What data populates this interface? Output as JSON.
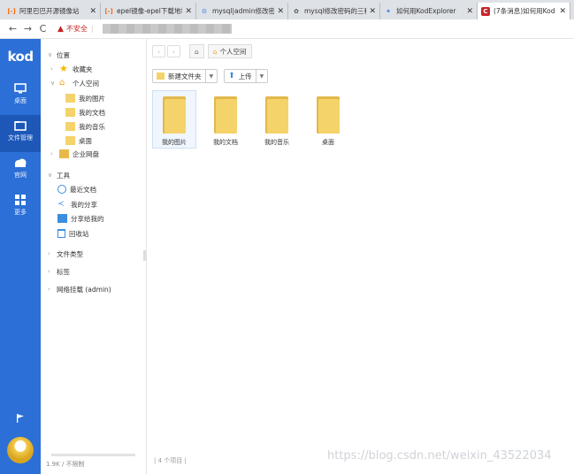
{
  "tabs": [
    {
      "title": "阿里巴巴开源镜像站",
      "fav_color": "#ff6a00",
      "fav_char": "[-]"
    },
    {
      "title": "epel镜像-epel下载地址",
      "fav_color": "#ff6a00",
      "fav_char": "[-]"
    },
    {
      "title": "mysql|admin修改密码",
      "fav_color": "#4a8af4",
      "fav_char": "⚙"
    },
    {
      "title": "mysql修改密码的三种",
      "fav_color": "#555555",
      "fav_char": "✿"
    },
    {
      "title": "如何用KodExplorer",
      "fav_color": "#3a7bd5",
      "fav_char": "✦"
    },
    {
      "title": "(7条消息)如何用Kod",
      "fav_color": "#c9252d",
      "fav_char": "C"
    }
  ],
  "address": {
    "security": "不安全"
  },
  "rail": {
    "logo": "kod",
    "items": [
      {
        "label": "桌面"
      },
      {
        "label": "文件管理"
      },
      {
        "label": "官网"
      },
      {
        "label": "更多"
      }
    ]
  },
  "tree": {
    "location": "位置",
    "favorites": "收藏夹",
    "personal": "个人空间",
    "sub": [
      "我的图片",
      "我的文档",
      "我的音乐",
      "桌面"
    ],
    "enterprise": "企业网盘",
    "tools": "工具",
    "tool_items": [
      "最近文档",
      "我的分享",
      "分享给我的",
      "回收站"
    ],
    "file_types": "文件类型",
    "tags": "标签",
    "network": "网络挂载 (admin)",
    "quota": "1.9K / 不限制"
  },
  "main": {
    "crumb": "个人空间",
    "new_folder": "新建文件夹",
    "upload": "上传",
    "files": [
      "我的图片",
      "我的文档",
      "我的音乐",
      "桌面"
    ],
    "status": "4 个项目"
  },
  "watermark": "https://blog.csdn.net/weixin_43522034",
  "colors": {
    "rail": "#2c6fd6",
    "folder": "#f5d36b"
  }
}
